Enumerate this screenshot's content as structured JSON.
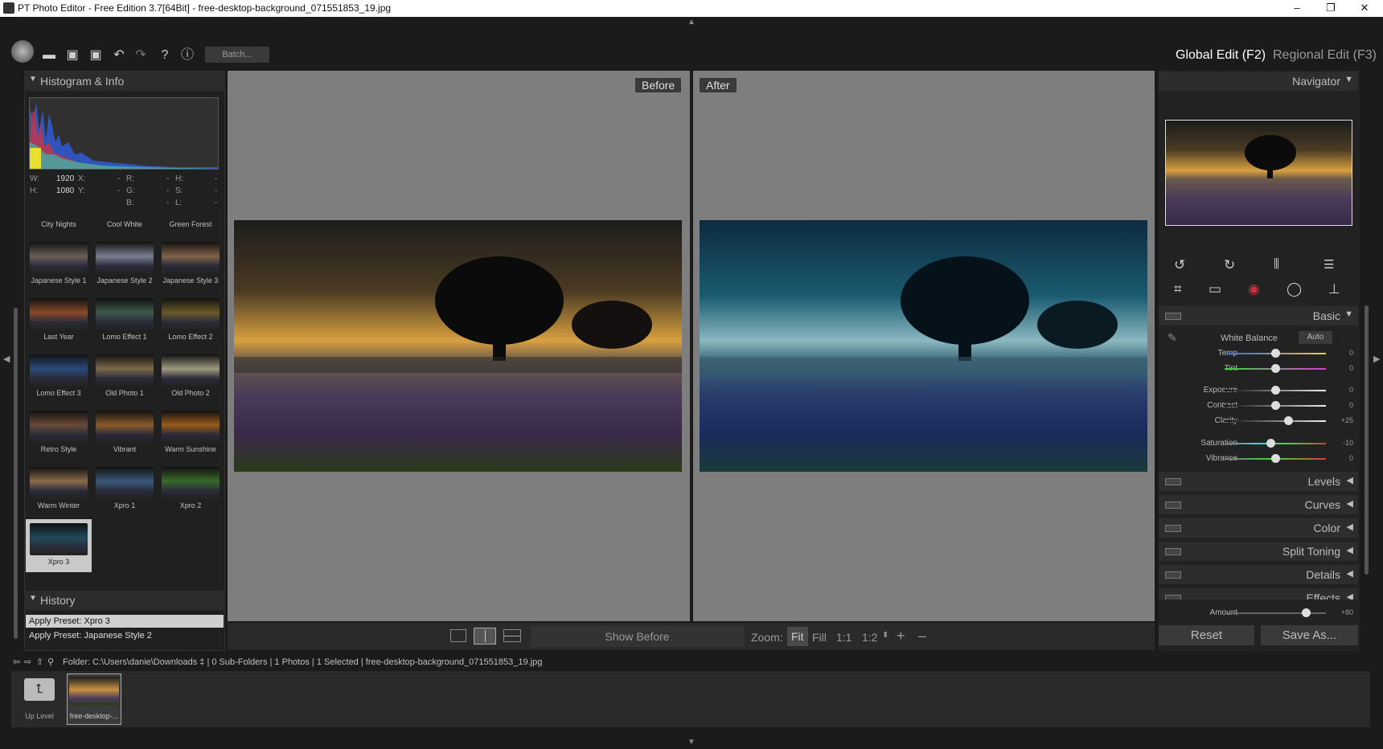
{
  "window": {
    "title": "PT Photo Editor - Free Edition 3.7[64Bit] - free-desktop-background_071551853_19.jpg",
    "minimize": "–",
    "maximize": "❐",
    "close": "✕"
  },
  "toolbar": {
    "batch_label": "Batch...",
    "global_edit": "Global Edit (F2)",
    "regional_edit": "Regional Edit (F3)",
    "help": "?",
    "info": "ⓘ"
  },
  "histogram": {
    "title": "Histogram & Info",
    "info": {
      "w_label": "W:",
      "w": "1920",
      "h_label": "H:",
      "h": "1080",
      "x_label": "X:",
      "x": "-",
      "y_label": "Y:",
      "y": "-",
      "r_label": "R:",
      "r": "-",
      "g_label": "G:",
      "g": "-",
      "b_label": "B:",
      "b": "-",
      "hh_label": "H:",
      "hh": "-",
      "s_label": "S:",
      "s": "-",
      "l_label": "L:",
      "l": "-"
    }
  },
  "presets": [
    {
      "name": "City Nights",
      "tone": "#6b5a3a"
    },
    {
      "name": "Cool White",
      "tone": "#51627a"
    },
    {
      "name": "Green Forest",
      "tone": "#2e6a5c"
    },
    {
      "name": "Japanese Style 1",
      "tone": "#6a5f57"
    },
    {
      "name": "Japanese Style 2",
      "tone": "#7a7f8f"
    },
    {
      "name": "Japanese Style 3",
      "tone": "#80624a"
    },
    {
      "name": "Last Year",
      "tone": "#8a4a2a"
    },
    {
      "name": "Lomo Effect 1",
      "tone": "#3e5a4a"
    },
    {
      "name": "Lomo Effect 2",
      "tone": "#6a5a2a"
    },
    {
      "name": "Lomo Effect 3",
      "tone": "#2a4a7a"
    },
    {
      "name": "Old Photo 1",
      "tone": "#7a6a4a"
    },
    {
      "name": "Old Photo 2",
      "tone": "#a09a80"
    },
    {
      "name": "Retro Style",
      "tone": "#6a4a3a"
    },
    {
      "name": "Vibrant",
      "tone": "#8a5a2a"
    },
    {
      "name": "Warm Sunshine",
      "tone": "#9a5a1a"
    },
    {
      "name": "Warm Winter",
      "tone": "#8a6a4a"
    },
    {
      "name": "Xpro 1",
      "tone": "#3a5a7a"
    },
    {
      "name": "Xpro 2",
      "tone": "#3a6a2a"
    },
    {
      "name": "Xpro 3",
      "tone": "#1e4a5a"
    }
  ],
  "history": {
    "title": "History",
    "items": [
      "Apply Preset: Xpro 3",
      "Apply Preset: Japanese Style 2"
    ]
  },
  "canvas": {
    "before_label": "Before",
    "after_label": "After"
  },
  "canvas_bar": {
    "show_before": "Show Before",
    "zoom_label": "Zoom:",
    "fit": "Fit",
    "fill": "Fill",
    "one_one": "1:1",
    "one_two": "1:2",
    "plus": "+",
    "minus": "–"
  },
  "navigator": {
    "title": "Navigator"
  },
  "basic": {
    "title": "Basic",
    "white_balance": "White Balance",
    "auto": "Auto",
    "sliders": [
      {
        "name": "Temp",
        "value": "0",
        "pos": 0.5,
        "grad": "linear-gradient(90deg,#3a62d8,#e8d23a)"
      },
      {
        "name": "Tint",
        "value": "0",
        "pos": 0.5,
        "grad": "linear-gradient(90deg,#3ad83a,#d83ad8)"
      },
      {
        "name": "Exposure",
        "value": "0",
        "pos": 0.5,
        "grad": "linear-gradient(90deg,#111,#eee)"
      },
      {
        "name": "Contrast",
        "value": "0",
        "pos": 0.5,
        "grad": "linear-gradient(90deg,#111,#eee)"
      },
      {
        "name": "Clarity",
        "value": "+25",
        "pos": 0.625,
        "grad": "linear-gradient(90deg,#111,#eee)"
      },
      {
        "name": "Saturation",
        "value": "-10",
        "pos": 0.45,
        "grad": "linear-gradient(90deg,#777,#3ad8d8,#3ad83a,#d83a3a)"
      },
      {
        "name": "Vibrance",
        "value": "0",
        "pos": 0.5,
        "grad": "linear-gradient(90deg,#777,#3ad83a,#d83a3a)"
      }
    ]
  },
  "sections": [
    "Levels",
    "Curves",
    "Color",
    "Split Toning",
    "Details",
    "Effects"
  ],
  "effects_amount": {
    "name": "Amount",
    "value": "+80",
    "pos": 0.8
  },
  "buttons": {
    "reset": "Reset",
    "save_as": "Save As..."
  },
  "status": {
    "folder_label": "Folder:",
    "path": "C:\\Users\\danie\\Downloads ‡ | 0 Sub-Folders | 1 Photos | 1 Selected | free-desktop-background_071551853_19.jpg"
  },
  "filmstrip": {
    "up_level": "Up Level",
    "file": "free-desktop-..."
  }
}
